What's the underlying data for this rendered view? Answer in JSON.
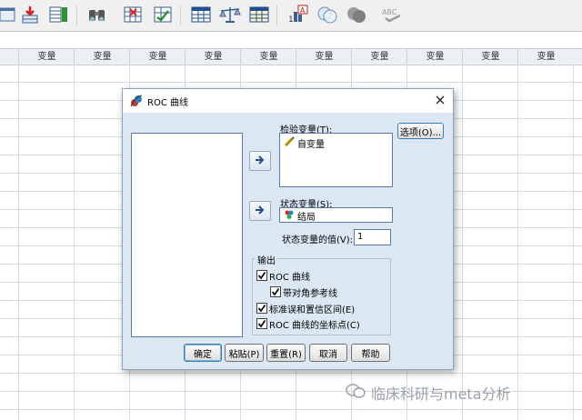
{
  "toolbar": {
    "icons": [
      "recall-dialog-icon",
      "go-to-case-icon",
      "variables-icon",
      "find-icon",
      "insert-cases-icon",
      "split-file-icon",
      "weight-cases-icon",
      "select-cases-icon",
      "value-labels-icon",
      "use-sets-icon",
      "show-all-variables-icon",
      "spell-check-icon"
    ],
    "abc_text": "ABC"
  },
  "spreadsheet": {
    "column_header": "变量",
    "column_count": 10
  },
  "dialog": {
    "title": "ROC 曲线",
    "test_variable_label": "检验变量(T):",
    "test_variable_items": [
      "自变量"
    ],
    "state_variable_label": "状态变量(S):",
    "state_variable_value": "结局",
    "state_value_label": "状态变量的值(V):",
    "state_value": "1",
    "options_button": "选项(O)...",
    "output_group_label": "输出",
    "checkboxes": {
      "roc_curve": {
        "label": "ROC 曲线",
        "checked": true
      },
      "diagonal_reference": {
        "label": "带对角参考线",
        "checked": true
      },
      "std_error_ci": {
        "label": "标准误和置信区间(E)",
        "checked": true
      },
      "roc_coordinates": {
        "label": "ROC 曲线的坐标点(C)",
        "checked": true
      }
    },
    "buttons": {
      "ok": "确定",
      "paste": "粘贴(P)",
      "reset": "重置(R)",
      "cancel": "取消",
      "help": "帮助"
    }
  },
  "watermark": {
    "text": "临床科研与meta分析"
  }
}
